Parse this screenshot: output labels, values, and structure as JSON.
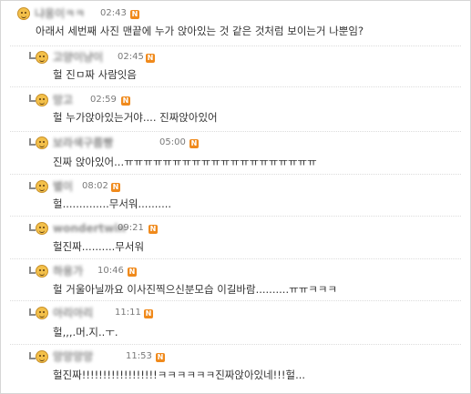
{
  "comments": [
    {
      "nickname": "냐옹이ㅋㅋ",
      "time": "02:43",
      "badge": "N",
      "text": "아래서 세번째 사진 맨끝에 누가 앉아있는 것 같은 것처럼 보이는거 나뿐임?"
    },
    {
      "nickname": "고양이냥이",
      "time": "02:45",
      "badge": "N",
      "text": "헐 진ㅁ짜 사람잇음"
    },
    {
      "nickname": "망고",
      "time": "02:59",
      "badge": "N",
      "text": "헐 누가앉아있는거야.... 진짜앉아있어"
    },
    {
      "nickname": "보라색구름빵",
      "time": "05:00",
      "badge": "N",
      "text": "진짜 앉아있어...ㅠㅠㅠㅠㅠㅠㅠㅠㅠㅠㅠㅠㅠㅠㅠㅠㅠㅠㅠㅠ"
    },
    {
      "nickname": "별이",
      "time": "08:02",
      "badge": "N",
      "text": "헐..............무서워.........."
    },
    {
      "nickname": "wondertwin",
      "time": "09:21",
      "badge": "N",
      "text": "헐진짜..........무서워"
    },
    {
      "nickname": "하용가",
      "time": "10:46",
      "badge": "N",
      "text": "헐 거울아닐까요 이사진찍으신분모습 이길바람..........ㅠㅠㅋㅋㅋ"
    },
    {
      "nickname": "아리아리",
      "time": "11:11",
      "badge": "N",
      "text": "헐,,,.머.지..ㅜ."
    },
    {
      "nickname": "앙앙앙앙",
      "time": "11:53",
      "badge": "N",
      "text": "헐진짜!!!!!!!!!!!!!!!!!!ㅋㅋㅋㅋㅋㅋ진짜앉아있네!!!헐..."
    }
  ]
}
